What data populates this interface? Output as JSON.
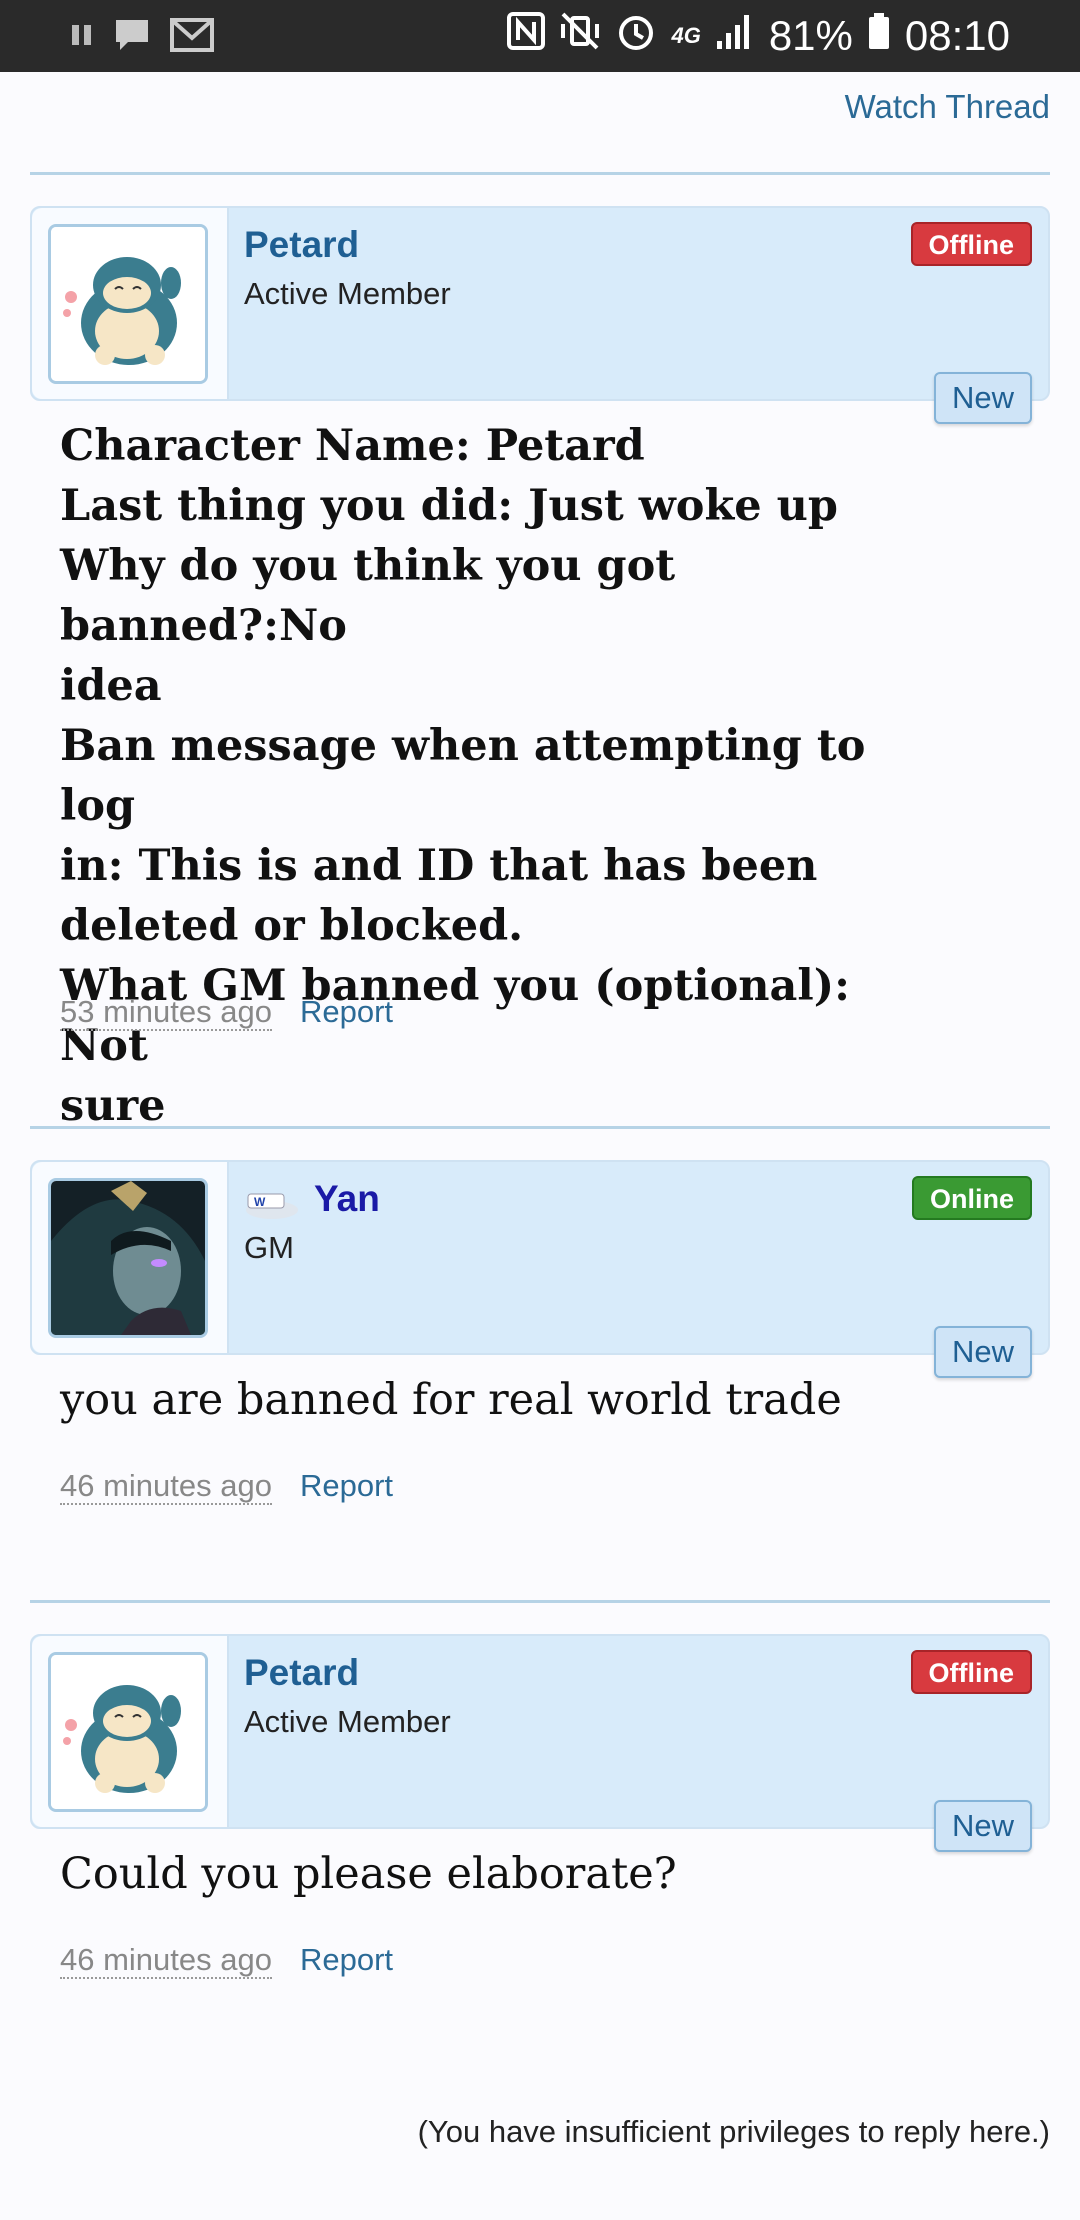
{
  "status_bar": {
    "battery": "81%",
    "time": "08:10",
    "network": "4G"
  },
  "thread": {
    "watch_label": "Watch Thread",
    "reply_notice": "(You have insufficient privileges to reply here.)"
  },
  "posts": [
    {
      "username": "Petard",
      "user_title": "Active Member",
      "status": "Offline",
      "new_label": "New",
      "message_lines": [
        "Character Name: Petard",
        "Last thing you did: Just woke up",
        "Why do you think you got banned?:No",
        "idea",
        "Ban message when attempting to log",
        "in: This is and ID that has been",
        "deleted or blocked.",
        "What GM banned you (optional): Not",
        "sure"
      ],
      "time": "53 minutes ago",
      "report_label": "Report"
    },
    {
      "username": "Yan",
      "user_title": "GM",
      "status": "Online",
      "new_label": "New",
      "message_lines": [
        "you are banned for real world trade"
      ],
      "time": "46 minutes ago",
      "report_label": "Report"
    },
    {
      "username": "Petard",
      "user_title": "Active Member",
      "status": "Offline",
      "new_label": "New",
      "message_lines": [
        "Could you please elaborate?"
      ],
      "time": "46 minutes ago",
      "report_label": "Report"
    }
  ],
  "colors": {
    "status_bar": "#2a2a2a",
    "header_bg": "#d8ebfa",
    "link": "#2b6a96",
    "offline": "#d83a3f",
    "online": "#3a9a33"
  }
}
